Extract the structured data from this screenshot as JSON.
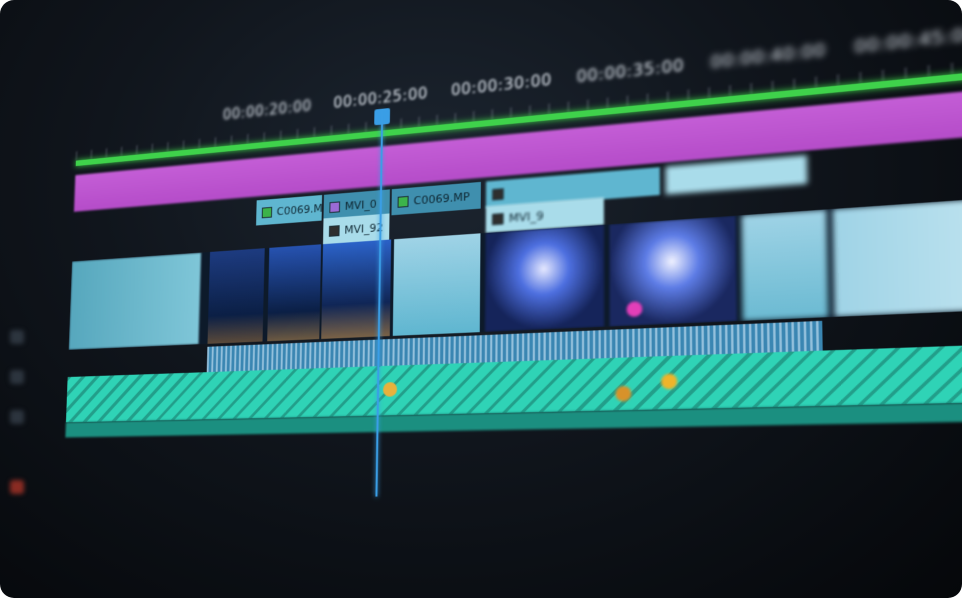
{
  "timeline": {
    "timecodes": [
      "00:00:20:00",
      "00:00:25:00",
      "00:00:30:00",
      "00:00:35:00",
      "00:00:40:00",
      "00:00:45:00"
    ],
    "playhead_time": "00:00:25:00",
    "clips_top": [
      {
        "label": "C0069.M",
        "badge": "green"
      },
      {
        "label": "MVI_0",
        "badge": "purple"
      },
      {
        "label": "C0069.MP",
        "badge": "green"
      }
    ],
    "clips_mid": [
      {
        "label": "MVI_92",
        "badge": "dark"
      },
      {
        "label": "MVI_9",
        "badge": "dark"
      }
    ]
  },
  "colors": {
    "background": "#10151c",
    "magenta_track": "#c45ed6",
    "green_bar": "#3fd24b",
    "clip_blue": "#5fb6d0",
    "audio_blue": "#3a86b2",
    "teal_track": "#2fd3b6",
    "playhead": "#3a9ee6"
  }
}
